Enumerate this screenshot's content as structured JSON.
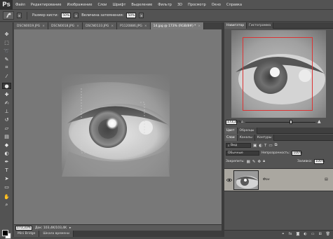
{
  "app": {
    "logo": "Ps"
  },
  "menu": [
    "Файл",
    "Редактирование",
    "Изображение",
    "Слои",
    "Шрифт",
    "Выделение",
    "Фильтр",
    "3D",
    "Просмотр",
    "Окно",
    "Справка"
  ],
  "options": {
    "brush_size_label": "Размер кисти:",
    "brush_size_value": "50%",
    "exposure_label": "Величина затемнения:",
    "exposure_value": "50%"
  },
  "document_tabs": [
    {
      "label": "DSCN0019.JPG",
      "active": false
    },
    {
      "label": "DSCN0018.JPG",
      "active": false
    },
    {
      "label": "DSCN0133.JPG",
      "active": false
    },
    {
      "label": "P1120886.JPG",
      "active": false
    },
    {
      "label": "14.jpg @ 173% (RGB/8#) *",
      "active": true
    }
  ],
  "status": {
    "zoom": "173,33%",
    "doc_info": "Док: 103,4K/103,4K"
  },
  "bottom_tabs": [
    "Mini Bridge",
    "Шкала времени"
  ],
  "navigator": {
    "tabs": [
      "Навигатор",
      "Гистограмма"
    ],
    "zoom": "173,33%",
    "zoom_level": 0.65
  },
  "color_panel": {
    "tabs": [
      "Цвет",
      "Образцы"
    ]
  },
  "layers_panel": {
    "tabs": [
      "Слои",
      "Каналы",
      "Контуры"
    ],
    "kind_label": "Вид",
    "blend_mode": "Обычные",
    "opacity_label": "Непрозрачность:",
    "opacity_value": "100%",
    "lock_label": "Закрепить:",
    "fill_label": "Заливка:",
    "fill_value": "100%",
    "layer_name": "Фон"
  },
  "colors": {
    "ui_dark": "#535353",
    "canvas_bg": "#787878",
    "layer_selected": "#aaa7a0",
    "nav_box": "#dd3333"
  }
}
